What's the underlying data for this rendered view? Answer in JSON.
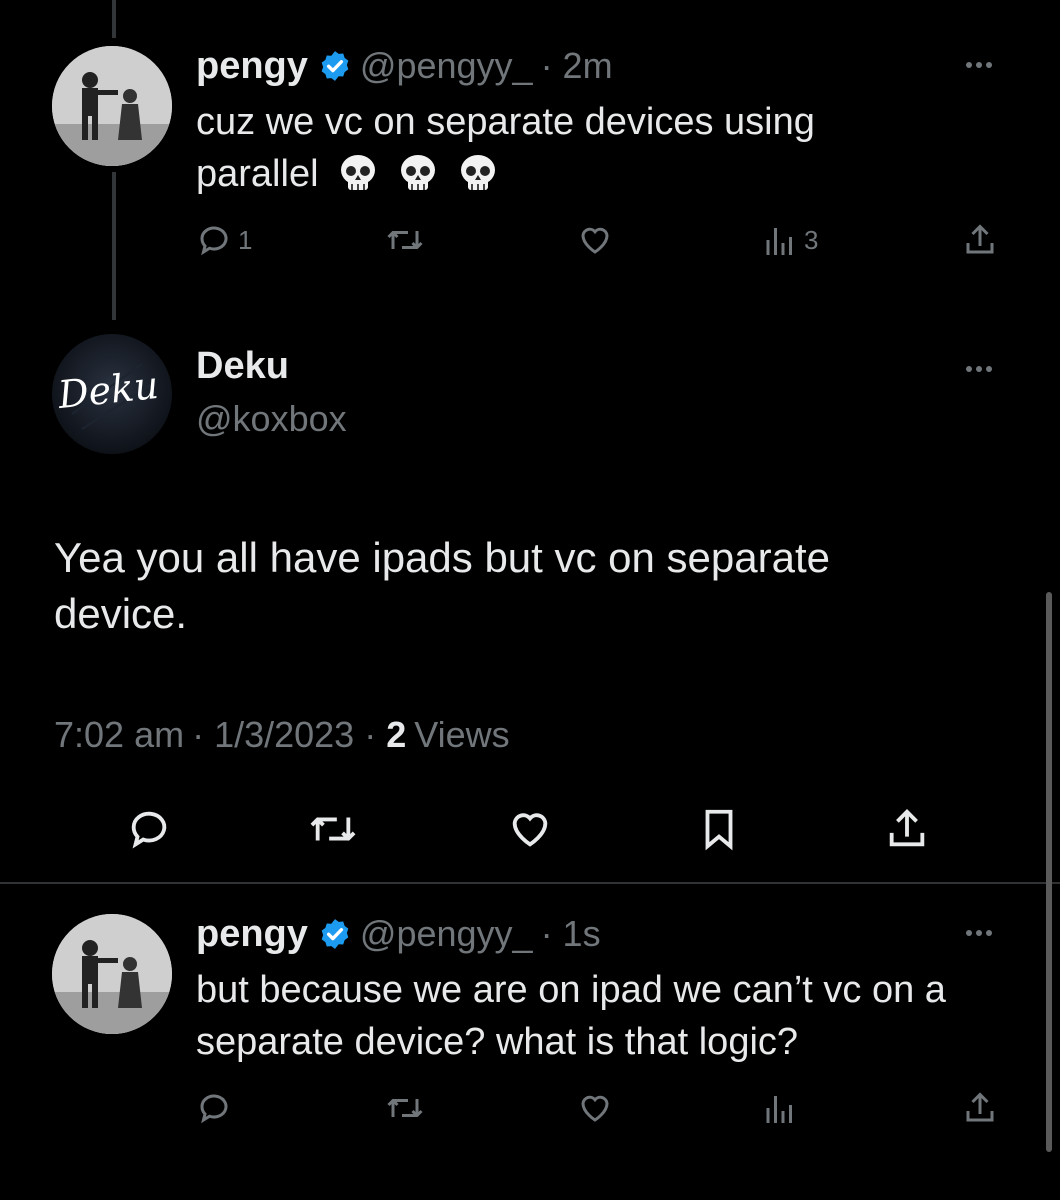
{
  "tweets": {
    "first": {
      "name": "pengy",
      "handle": "@pengyy_",
      "time": "· 2m",
      "text_line1": "cuz we vc on separate devices using",
      "text_line2": "parallel",
      "replies": "1",
      "views": "3",
      "avatar_icon": "silhouette-photo"
    },
    "main": {
      "name": "Deku",
      "handle": "@koxbox",
      "avatar_text": "Deku",
      "text_line1": "Yea you all have ipads but vc on separate",
      "text_line2": "device.",
      "time": "7:02 am",
      "date": "· 1/3/2023 ·",
      "views_count": "2",
      "views_label": "Views"
    },
    "reply": {
      "name": "pengy",
      "handle": "@pengyy_",
      "time": "· 1s",
      "text_line1": "but because we are on ipad we can’t vc on a",
      "text_line2": "separate device? what is that logic?",
      "avatar_icon": "silhouette-photo"
    }
  },
  "colors": {
    "background": "#000000",
    "text": "#e7e9ea",
    "muted": "#71767b",
    "verified": "#1d9bf0",
    "divider": "#2f3336"
  },
  "icons": [
    "reply-icon",
    "retweet-icon",
    "like-icon",
    "views-icon",
    "share-icon",
    "bookmark-icon",
    "more-icon",
    "verified-badge-icon",
    "skull-emoji"
  ]
}
